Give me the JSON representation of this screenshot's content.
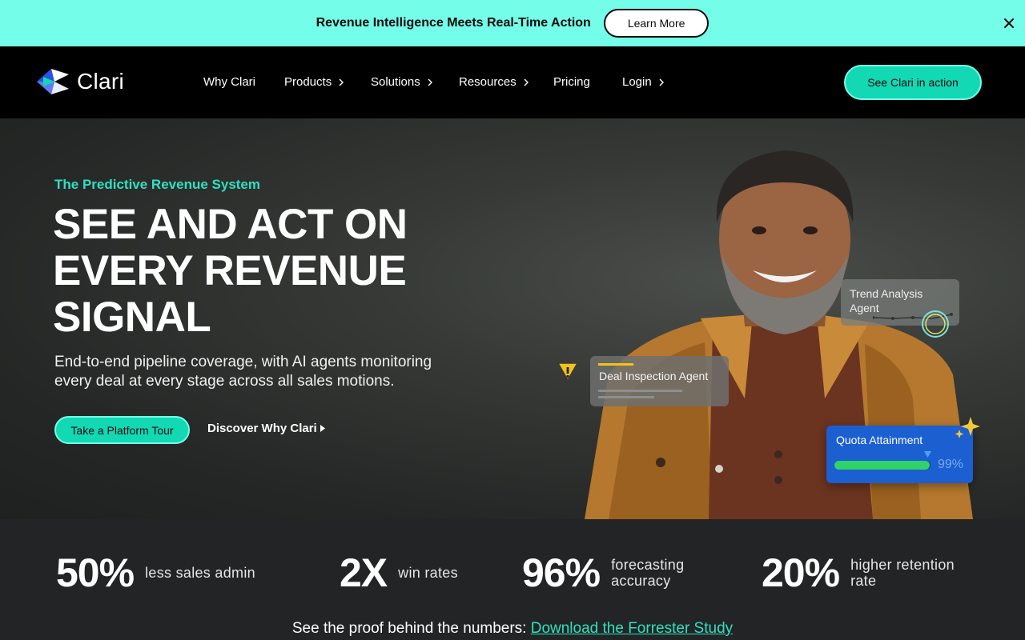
{
  "announcement": {
    "text": "Revenue Intelligence Meets Real-Time Action",
    "button_label": "Learn More",
    "close_icon": "close-icon"
  },
  "nav": {
    "logo_text": "Clari",
    "items": [
      {
        "label": "Why Clari",
        "has_chevron": false
      },
      {
        "label": "Products",
        "has_chevron": true
      },
      {
        "label": "Solutions",
        "has_chevron": true
      },
      {
        "label": "Resources",
        "has_chevron": true
      },
      {
        "label": "Pricing",
        "has_chevron": false
      },
      {
        "label": "Login",
        "has_chevron": true
      }
    ],
    "cta_label": "See Clari in action"
  },
  "hero": {
    "eyebrow": "The Predictive Revenue System",
    "headline_lines": [
      "SEE AND ACT ON",
      "EVERY REVENUE",
      "SIGNAL"
    ],
    "subtext": "End-to-end pipeline coverage, with AI agents monitoring every deal at every stage across all sales motions.",
    "primary_button": "Take a Platform Tour",
    "secondary_link": "Discover Why Clari",
    "cards": {
      "trend": "Trend Analysis Agent",
      "deal": "Deal Inspection Agent",
      "quota_label": "Quota Attainment",
      "quota_value": "99%",
      "quota_fraction": 0.99
    }
  },
  "stats": [
    {
      "value": "50%",
      "label": "less sales admin"
    },
    {
      "value": "2X",
      "label": "win rates"
    },
    {
      "value": "96%",
      "label": "forecasting accuracy"
    },
    {
      "value": "20%",
      "label": "higher retention rate"
    }
  ],
  "proof": {
    "text": "See the proof behind the numbers: ",
    "link": "Download the Forrester Study"
  },
  "colors": {
    "accent": "#13d8b4",
    "announcement_bg": "#74fde8",
    "quota_card": "#1c5fd0"
  }
}
